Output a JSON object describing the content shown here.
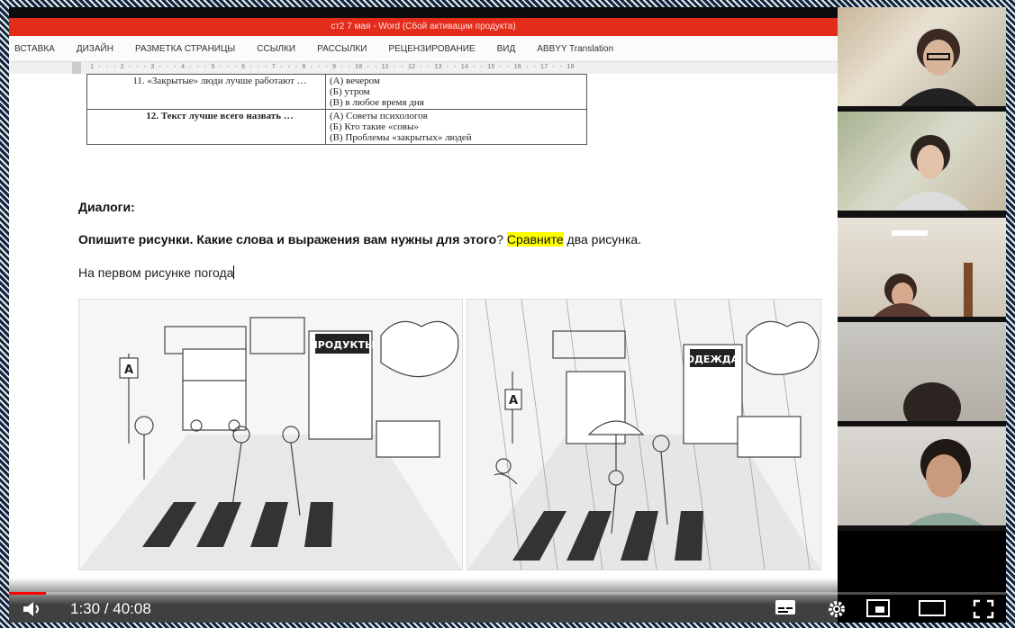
{
  "word": {
    "title": "ст2 7 мая - Word (Сбой активации продукта)",
    "ribbon_tabs": [
      "ВСТАВКА",
      "ДИЗАЙН",
      "РАЗМЕТКА СТРАНИЦЫ",
      "ССЫЛКИ",
      "РАССЫЛКИ",
      "РЕЦЕНЗИРОВАНИЕ",
      "ВИД",
      "ABBYY Translation"
    ],
    "ruler_numbers": "1 · · · 2 · · · 3 · · · 4 · · · 5 · · · 6 · · · 7 · · · 8 · · · 9 · · 10 · · 11 · · 12 · · 13 · · 14 · · 15 · · 16 · · 17 · · 18"
  },
  "document": {
    "q11": {
      "question": "11. «Закрытые» люди лучше работают …",
      "options": [
        "(А) вечером",
        "(Б) утром",
        "(В) в любое время дня"
      ]
    },
    "q12": {
      "question": "12. Текст лучше всего назвать …",
      "options": [
        "(А) Советы психологов",
        "(Б) Кто такие «совы»",
        "(В) Проблемы «закрытых» людей"
      ]
    },
    "dialogs_heading": "Диалоги:",
    "task_bold": "Опишите рисунки. Какие слова и выражения вам нужны для этого",
    "task_q": "?",
    "task_highlight": "Сравните",
    "task_rest": " два рисунка.",
    "draft_text": "На первом рисунке погода",
    "pic1_bus_sign": "А",
    "pic1_shop_sign": "ПРОДУКТЫ",
    "pic2_bus_sign": "А",
    "pic2_shop_sign": "ОДЕЖДА"
  },
  "player": {
    "time": "1:30 / 40:08",
    "progress_fraction": 0.037
  },
  "colors": {
    "titlebar": "#e42c1c",
    "highlight": "#ffff00",
    "progress": "#ff0000"
  }
}
